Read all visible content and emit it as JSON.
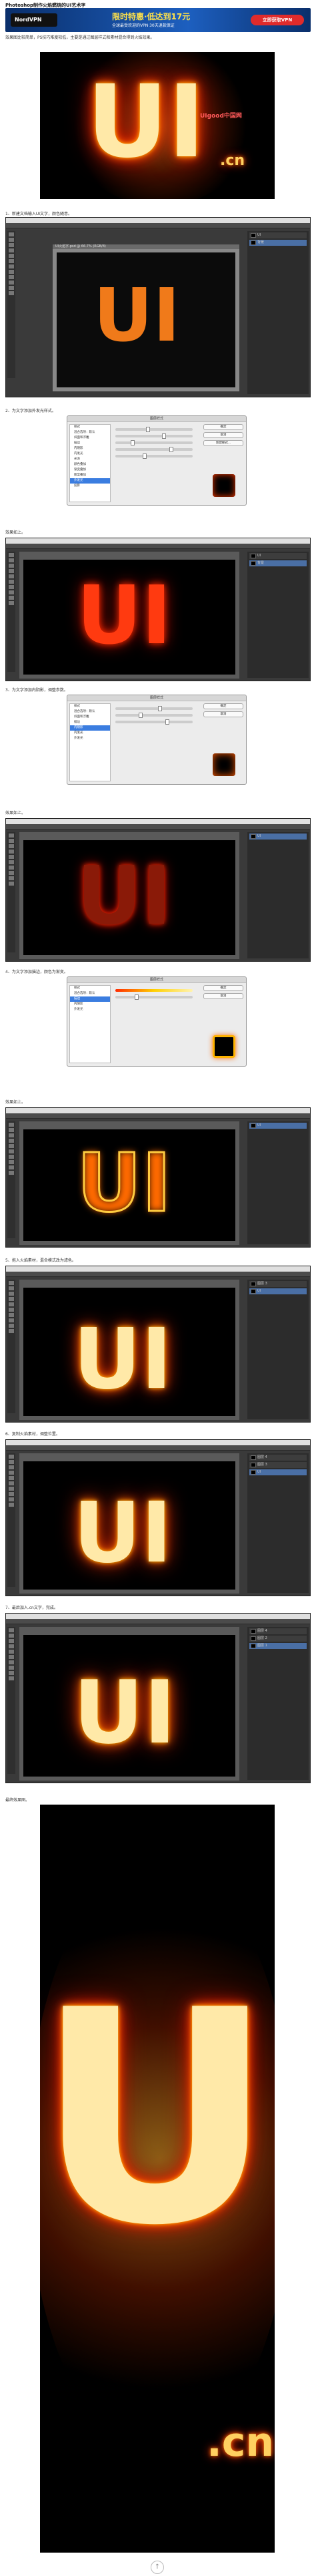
{
  "page": {
    "title": "Photoshop制作火焰燃烧的UI艺术字"
  },
  "ad": {
    "brand": "NordVPN",
    "headline": "限时特惠·低达到17元",
    "sub": "全球最受欢迎的VPN·30天退款保证",
    "cta": "立即获取VPN"
  },
  "intro": "效果图比较简单，PS技巧难度较低，主要是通过图层样式和素材混合得到火焰效果。",
  "fire_hero": {
    "text_big": "UI",
    "text_small": ".cn",
    "watermark": "UIgood中国网"
  },
  "steps": [
    {
      "caption": "1、新建文档输入UI文字，颜色随意。",
      "ps_text": "UI",
      "tab": "UI火焰字.psd @ 66.7% (RGB/8)"
    },
    {
      "caption": "2、为文字添加外发光样式。",
      "dialog_title": "图层样式"
    },
    {
      "caption": "效果如上。",
      "ps_text": "UI"
    },
    {
      "caption": "3、为文字添加内阴影，调整参数。",
      "dialog_title": "图层样式"
    },
    {
      "caption": "效果如上。",
      "ps_text": "UI"
    },
    {
      "caption": "4、为文字添加描边，颜色为渐变。",
      "dialog_title": "图层样式"
    },
    {
      "caption": "效果如上。",
      "ps_text": "UI"
    },
    {
      "caption": "5、拖入火焰素材，混合模式改为滤色。",
      "ps_text": "UI"
    },
    {
      "caption": "6、复制火焰素材，调整位置。",
      "ps_text": "UI"
    },
    {
      "caption": "7、最后加入.cn文字，完成。",
      "ps_text": "UI"
    },
    {
      "caption": "最终效果图。"
    }
  ],
  "final": {
    "text_big": "UI",
    "text_small": ".cn"
  },
  "ps": {
    "menu": [
      "Photoshop CC",
      "文件",
      "编辑",
      "图像",
      "图层",
      "文字",
      "选择",
      "滤镜",
      "视图",
      "窗口",
      "帮助"
    ],
    "layers": [
      "图层 4",
      "图层 3",
      "图层 2",
      "图层 1",
      "UI",
      "背景"
    ],
    "dlg_list": [
      "样式",
      "混合选项：默认",
      "斜面和浮雕",
      "描边",
      "内阴影",
      "内发光",
      "光泽",
      "颜色叠加",
      "渐变叠加",
      "图案叠加",
      "外发光",
      "投影"
    ],
    "dlg_buttons": [
      "确定",
      "取消",
      "新建样式...",
      "预览"
    ]
  },
  "scrolltop": "↑"
}
